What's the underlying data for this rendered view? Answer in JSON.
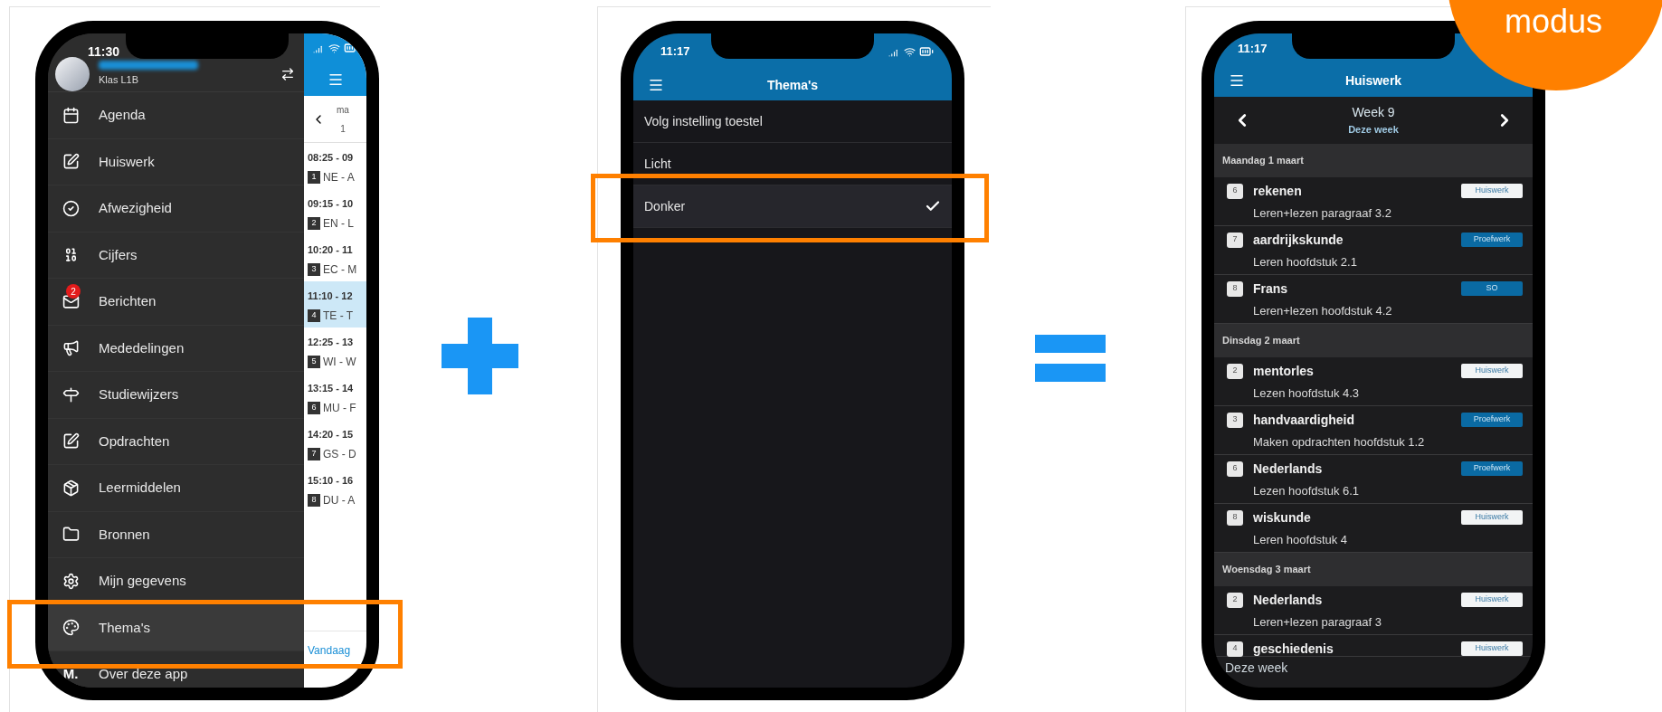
{
  "menu_screen": {
    "time": "11:30",
    "user_class": "Klas L1B",
    "menu_items": [
      {
        "label": "Agenda",
        "highlighted": false
      },
      {
        "label": "Huiswerk",
        "highlighted": false
      },
      {
        "label": "Afwezigheid",
        "highlighted": false
      },
      {
        "label": "Cijfers",
        "highlighted": false
      },
      {
        "label": "Berichten",
        "badge": "2",
        "highlighted": false
      },
      {
        "label": "Mededelingen",
        "highlighted": false
      },
      {
        "label": "Studiewijzers",
        "highlighted": false
      },
      {
        "label": "Opdrachten",
        "highlighted": false
      },
      {
        "label": "Leermiddelen",
        "highlighted": false
      },
      {
        "label": "Bronnen",
        "highlighted": false
      },
      {
        "label": "Mijn gegevens",
        "highlighted": false
      },
      {
        "label": "Thema's",
        "highlighted": true
      },
      {
        "label": "Over deze app",
        "logo": "M.",
        "highlighted": false
      }
    ],
    "calendar": {
      "day": "ma",
      "date": "1",
      "today_link": "Vandaag",
      "lessons": [
        {
          "time": "08:25 - 09",
          "hour": "1",
          "subject": "NE - A",
          "selected": false
        },
        {
          "time": "09:15 - 10",
          "hour": "2",
          "subject": "EN - L",
          "selected": false
        },
        {
          "time": "10:20 - 11",
          "hour": "3",
          "subject": "EC - M",
          "selected": false
        },
        {
          "time": "11:10 - 12",
          "hour": "4",
          "subject": "TE - T",
          "selected": true
        },
        {
          "time": "12:25 - 13",
          "hour": "5",
          "subject": "WI - W",
          "selected": false
        },
        {
          "time": "13:15 - 14",
          "hour": "6",
          "subject": "MU - F",
          "selected": false
        },
        {
          "time": "14:20 - 15",
          "hour": "7",
          "subject": "GS - D",
          "selected": false
        },
        {
          "time": "15:10 - 16",
          "hour": "8",
          "subject": "DU - A",
          "selected": false
        }
      ]
    }
  },
  "theme_screen": {
    "time": "11:17",
    "title": "Thema's",
    "options": [
      {
        "label": "Volg instelling toestel",
        "selected": false,
        "highlighted": false
      },
      {
        "label": "Licht",
        "selected": false,
        "highlighted": false
      },
      {
        "label": "Donker",
        "selected": true,
        "highlighted": true
      }
    ]
  },
  "homework_screen": {
    "time": "11:17",
    "title": "Huiswerk",
    "week": "Week 9",
    "week_label": "Deze week",
    "days": [
      {
        "date": "Maandag 1 maart",
        "items": [
          {
            "hour": "6",
            "subject": "rekenen",
            "tag": "Huiswerk",
            "kind": "homework",
            "description": "Leren+lezen paragraaf 3.2"
          },
          {
            "hour": "7",
            "subject": "aardrijkskunde",
            "tag": "Proefwerk",
            "kind": "test",
            "description": "Leren hoofdstuk 2.1"
          },
          {
            "hour": "8",
            "subject": "Frans",
            "tag": "SO",
            "kind": "test",
            "description": "Leren+lezen hoofdstuk 4.2"
          }
        ]
      },
      {
        "date": "Dinsdag 2 maart",
        "items": [
          {
            "hour": "2",
            "subject": "mentorles",
            "tag": "Huiswerk",
            "kind": "homework",
            "description": "Lezen hoofdstuk 4.3"
          },
          {
            "hour": "3",
            "subject": "handvaardigheid",
            "tag": "Proefwerk",
            "kind": "test",
            "description": "Maken opdrachten hoofdstuk 1.2"
          },
          {
            "hour": "6",
            "subject": "Nederlands",
            "tag": "Proefwerk",
            "kind": "test",
            "description": "Lezen hoofdstuk 6.1"
          },
          {
            "hour": "8",
            "subject": "wiskunde",
            "tag": "Huiswerk",
            "kind": "homework",
            "description": "Leren hoofdstuk 4"
          }
        ]
      },
      {
        "date": "Woensdag 3 maart",
        "items": [
          {
            "hour": "2",
            "subject": "Nederlands",
            "tag": "Huiswerk",
            "kind": "homework",
            "description": "Leren+lezen paragraaf 3"
          },
          {
            "hour": "4",
            "subject": "geschiedenis",
            "tag": "Huiswerk",
            "kind": "homework"
          }
        ]
      }
    ],
    "footer": "Deze week"
  },
  "corner_badge": "modus"
}
